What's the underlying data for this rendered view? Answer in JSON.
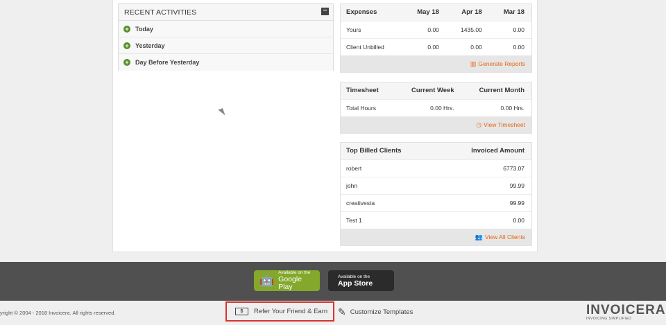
{
  "activities": {
    "title": "RECENT ACTIVITIES",
    "collapse": "−",
    "items": [
      "Today",
      "Yesterday",
      "Day Before Yesterday"
    ]
  },
  "expenses": {
    "headers": [
      "Expenses",
      "May 18",
      "Apr 18",
      "Mar 18"
    ],
    "rows": [
      [
        "Yours",
        "0.00",
        "1435.00",
        "0.00"
      ],
      [
        "Client Unbilled",
        "0.00",
        "0.00",
        "0.00"
      ]
    ],
    "link": "Generate Reports"
  },
  "timesheet": {
    "headers": [
      "Timesheet",
      "Current Week",
      "Current Month"
    ],
    "rows": [
      [
        "Total Hours",
        "0.00 Hrs.",
        "0.00 Hrs."
      ]
    ],
    "link": "View Timesheet"
  },
  "clients": {
    "headers": [
      "Top Billed Clients",
      "Invoiced Amount"
    ],
    "rows": [
      [
        "robert",
        "6773.07"
      ],
      [
        "john",
        "99.99"
      ],
      [
        "creativesta",
        "99.99"
      ],
      [
        "Test 1",
        "0.00"
      ]
    ],
    "link": "View All Clients"
  },
  "footer": {
    "google_play": {
      "small": "Available on the",
      "big": "Google Play"
    },
    "app_store": {
      "small": "Available on the",
      "big": "App Store"
    },
    "copyright": "yright © 2004 - 2018 Invoicera. All rights reserved.",
    "refer": "Refer Your Friend & Earn",
    "customize": "Customize Templates",
    "brand": "INVOICERA",
    "brand_tag": "INVOICING SIMPLIFIED"
  },
  "colors": {
    "accent": "#e8650e",
    "highlight_border": "#d9322f",
    "google_green": "#83a82b"
  }
}
